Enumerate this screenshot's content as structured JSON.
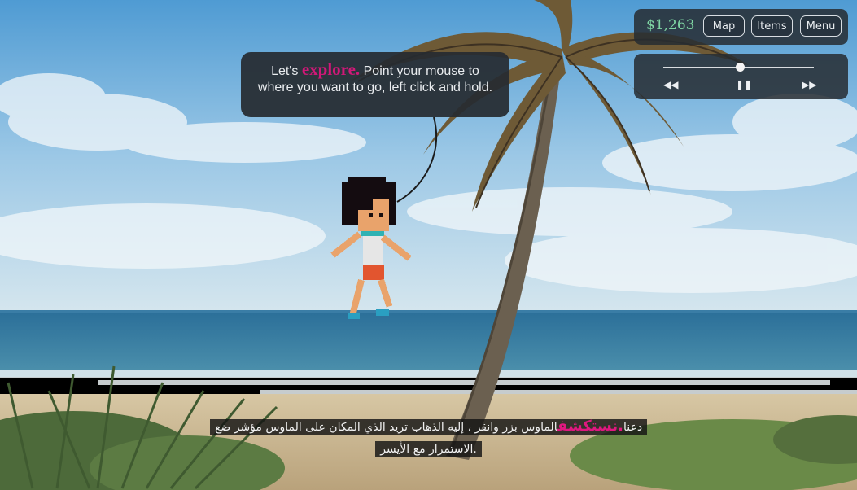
{
  "hud": {
    "money": "$1,263",
    "buttons": {
      "map": "Map",
      "items": "Items",
      "menu": "Menu"
    }
  },
  "media": {
    "progress": 0.51,
    "rewind_icon": "rewind-icon",
    "pause_icon": "pause-icon",
    "forward_icon": "fast-forward-icon"
  },
  "dialog": {
    "prefix": "Let's ",
    "keyword": "explore.",
    "suffix": " Point your mouse to where you want to go, left click and hold.",
    "keyword_color": "#d01878"
  },
  "subtitle": {
    "line1_text": "الماوس بزر وانقر ، إليه الذهاب تريد الذي المكان على الماوس مؤشر ضع ",
    "line1_keyword": ".نستكشف",
    "line1_end": " دعنا",
    "line2": ".الاستمرار مع الأيسر"
  },
  "colors": {
    "accent": "#d01878",
    "money": "#7fd6a4"
  }
}
